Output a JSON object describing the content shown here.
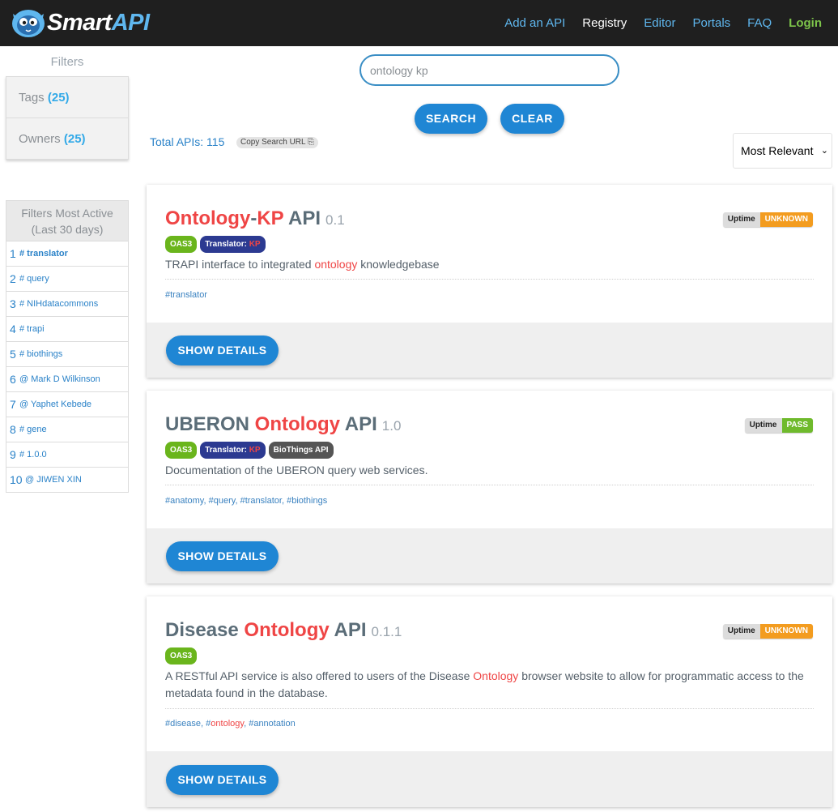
{
  "header": {
    "logo_text_left": "Smart",
    "logo_text_right": "API",
    "nav": [
      {
        "label": "Add an API"
      },
      {
        "label": "Registry"
      },
      {
        "label": "Editor"
      },
      {
        "label": "Portals"
      },
      {
        "label": "FAQ"
      },
      {
        "label": "Login"
      }
    ]
  },
  "sidebar": {
    "filters_title": "Filters",
    "tags_label": "Tags",
    "tags_count": "(25)",
    "owners_label": "Owners",
    "owners_count": "(25)",
    "active_title_line1": "Filters Most Active",
    "active_title_line2": "(Last 30 days)",
    "active": [
      {
        "num": "1",
        "label": "# translator"
      },
      {
        "num": "2",
        "label": "# query"
      },
      {
        "num": "3",
        "label": "# NIHdatacommons"
      },
      {
        "num": "4",
        "label": "# trapi"
      },
      {
        "num": "5",
        "label": "# biothings"
      },
      {
        "num": "6",
        "label": "@ Mark D Wilkinson"
      },
      {
        "num": "7",
        "label": "@ Yaphet Kebede"
      },
      {
        "num": "8",
        "label": "# gene"
      },
      {
        "num": "9",
        "label": "# 1.0.0"
      },
      {
        "num": "10",
        "label": "@ JIWEN XIN"
      }
    ]
  },
  "search": {
    "value": "ontology kp",
    "search_label": "SEARCH",
    "clear_label": "CLEAR",
    "total": "Total APIs: 115",
    "copy_label": "Copy Search URL",
    "sort_selected": "Most Relevant"
  },
  "cards": [
    {
      "title_a": "Ontology",
      "title_b": "-",
      "title_c": "KP",
      "title_d": " API",
      "version": "0.1",
      "uptime_label": "Uptime",
      "uptime_status": "UNKNOWN",
      "badge_oas": "OAS3",
      "badge_translator": "Translator: ",
      "badge_kp": "KP",
      "desc_pre": "TRAPI interface to integrated ",
      "desc_hl": "ontology",
      "desc_post": " knowledgebase",
      "tags": [
        "#translator"
      ],
      "details_label": "SHOW DETAILS"
    },
    {
      "title_a": "UBERON ",
      "title_b": "Ontology",
      "title_c": " API",
      "version": "1.0",
      "uptime_label": "Uptime",
      "uptime_status": "PASS",
      "badge_oas": "OAS3",
      "badge_translator": "Translator: ",
      "badge_kp": "KP",
      "badge_bio": "BioThings API",
      "desc": "Documentation of the UBERON query web services.",
      "tags": [
        "#anatomy",
        "#query",
        "#translator",
        "#biothings"
      ],
      "details_label": "SHOW DETAILS"
    },
    {
      "title_a": "Disease ",
      "title_b": "Ontology",
      "title_c": " API",
      "version": "0.1.1",
      "uptime_label": "Uptime",
      "uptime_status": "UNKNOWN",
      "badge_oas": "OAS3",
      "desc_pre": "A RESTful API service is also offered to users of the Disease ",
      "desc_hl": "Ontology",
      "desc_post": " browser website to allow for programmatic access to the metadata found in the database.",
      "tag_1": "#disease",
      "tag_2_prefix": "#",
      "tag_2_hl": "ontology",
      "tag_3": "#annotation",
      "details_label": "SHOW DETAILS"
    }
  ],
  "colors": {
    "accent": "#1f86d4",
    "highlight": "#ef4545",
    "header_bg": "#1f1f1f",
    "uptime_unknown": "#f39c1f",
    "uptime_pass": "#6fba2c",
    "oas_badge": "#6ab51c"
  }
}
